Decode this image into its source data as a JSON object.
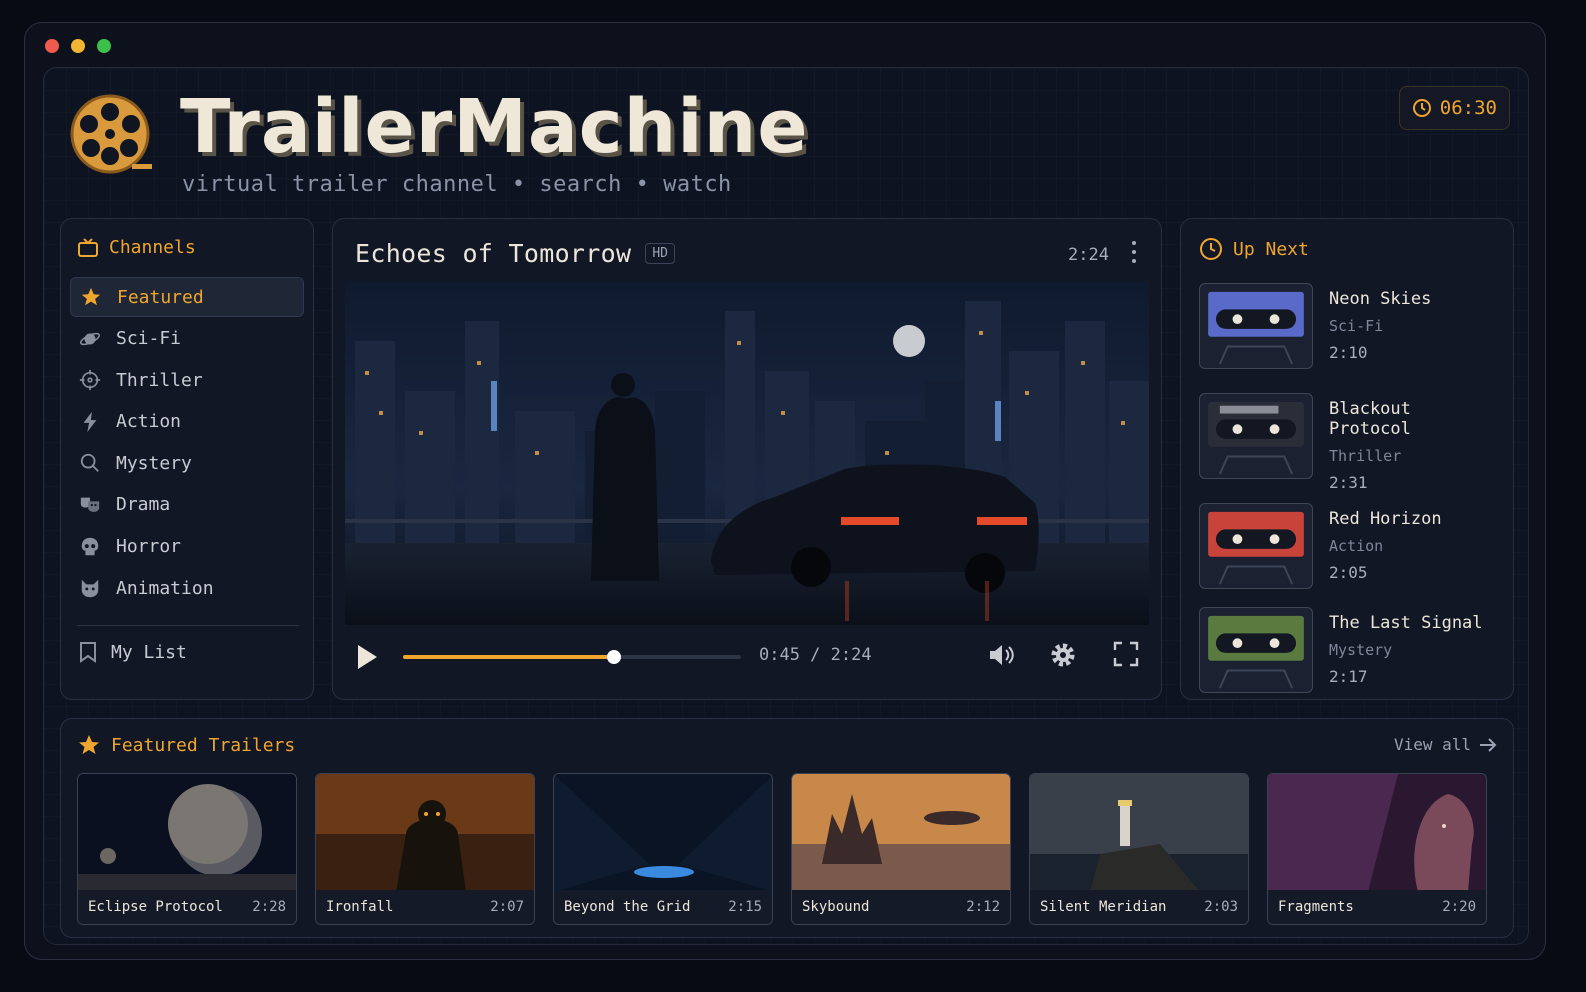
{
  "app": {
    "name": "TrailerMachine",
    "tagline": "virtual trailer channel • search • watch",
    "clock": "06:30",
    "colors": {
      "accent": "#f0a52e",
      "background": "#0d1320",
      "panel": "#111725"
    }
  },
  "channels": {
    "title": "Channels",
    "items": [
      {
        "label": "Featured",
        "icon": "star-icon",
        "active": true
      },
      {
        "label": "Sci-Fi",
        "icon": "planet-icon"
      },
      {
        "label": "Thriller",
        "icon": "crosshair-icon"
      },
      {
        "label": "Action",
        "icon": "lightning-icon"
      },
      {
        "label": "Mystery",
        "icon": "magnifier-icon"
      },
      {
        "label": "Drama",
        "icon": "masks-icon"
      },
      {
        "label": "Horror",
        "icon": "skull-icon"
      },
      {
        "label": "Animation",
        "icon": "cat-icon"
      }
    ],
    "my_list": "My List"
  },
  "player": {
    "title": "Echoes of Tomorrow",
    "badge": "HD",
    "duration": "2:24",
    "time_display": "0:45 / 2:24",
    "progress": 0.625
  },
  "up_next": {
    "title": "Up Next",
    "items": [
      {
        "title": "Neon Skies",
        "genre": "Sci-Fi",
        "time": "2:10",
        "color": "#5a6ac8"
      },
      {
        "title": "Blackout Protocol",
        "genre": "Thriller",
        "time": "2:31",
        "color": "#8a8d95"
      },
      {
        "title": "Red Horizon",
        "genre": "Action",
        "time": "2:05",
        "color": "#c8443a"
      },
      {
        "title": "The Last Signal",
        "genre": "Mystery",
        "time": "2:17",
        "color": "#5a7a40"
      }
    ]
  },
  "featured": {
    "title": "Featured Trailers",
    "view_all": "View all",
    "items": [
      {
        "title": "Eclipse Protocol",
        "time": "2:28"
      },
      {
        "title": "Ironfall",
        "time": "2:07"
      },
      {
        "title": "Beyond the Grid",
        "time": "2:15"
      },
      {
        "title": "Skybound",
        "time": "2:12"
      },
      {
        "title": "Silent Meridian",
        "time": "2:03"
      },
      {
        "title": "Fragments",
        "time": "2:20"
      }
    ]
  }
}
